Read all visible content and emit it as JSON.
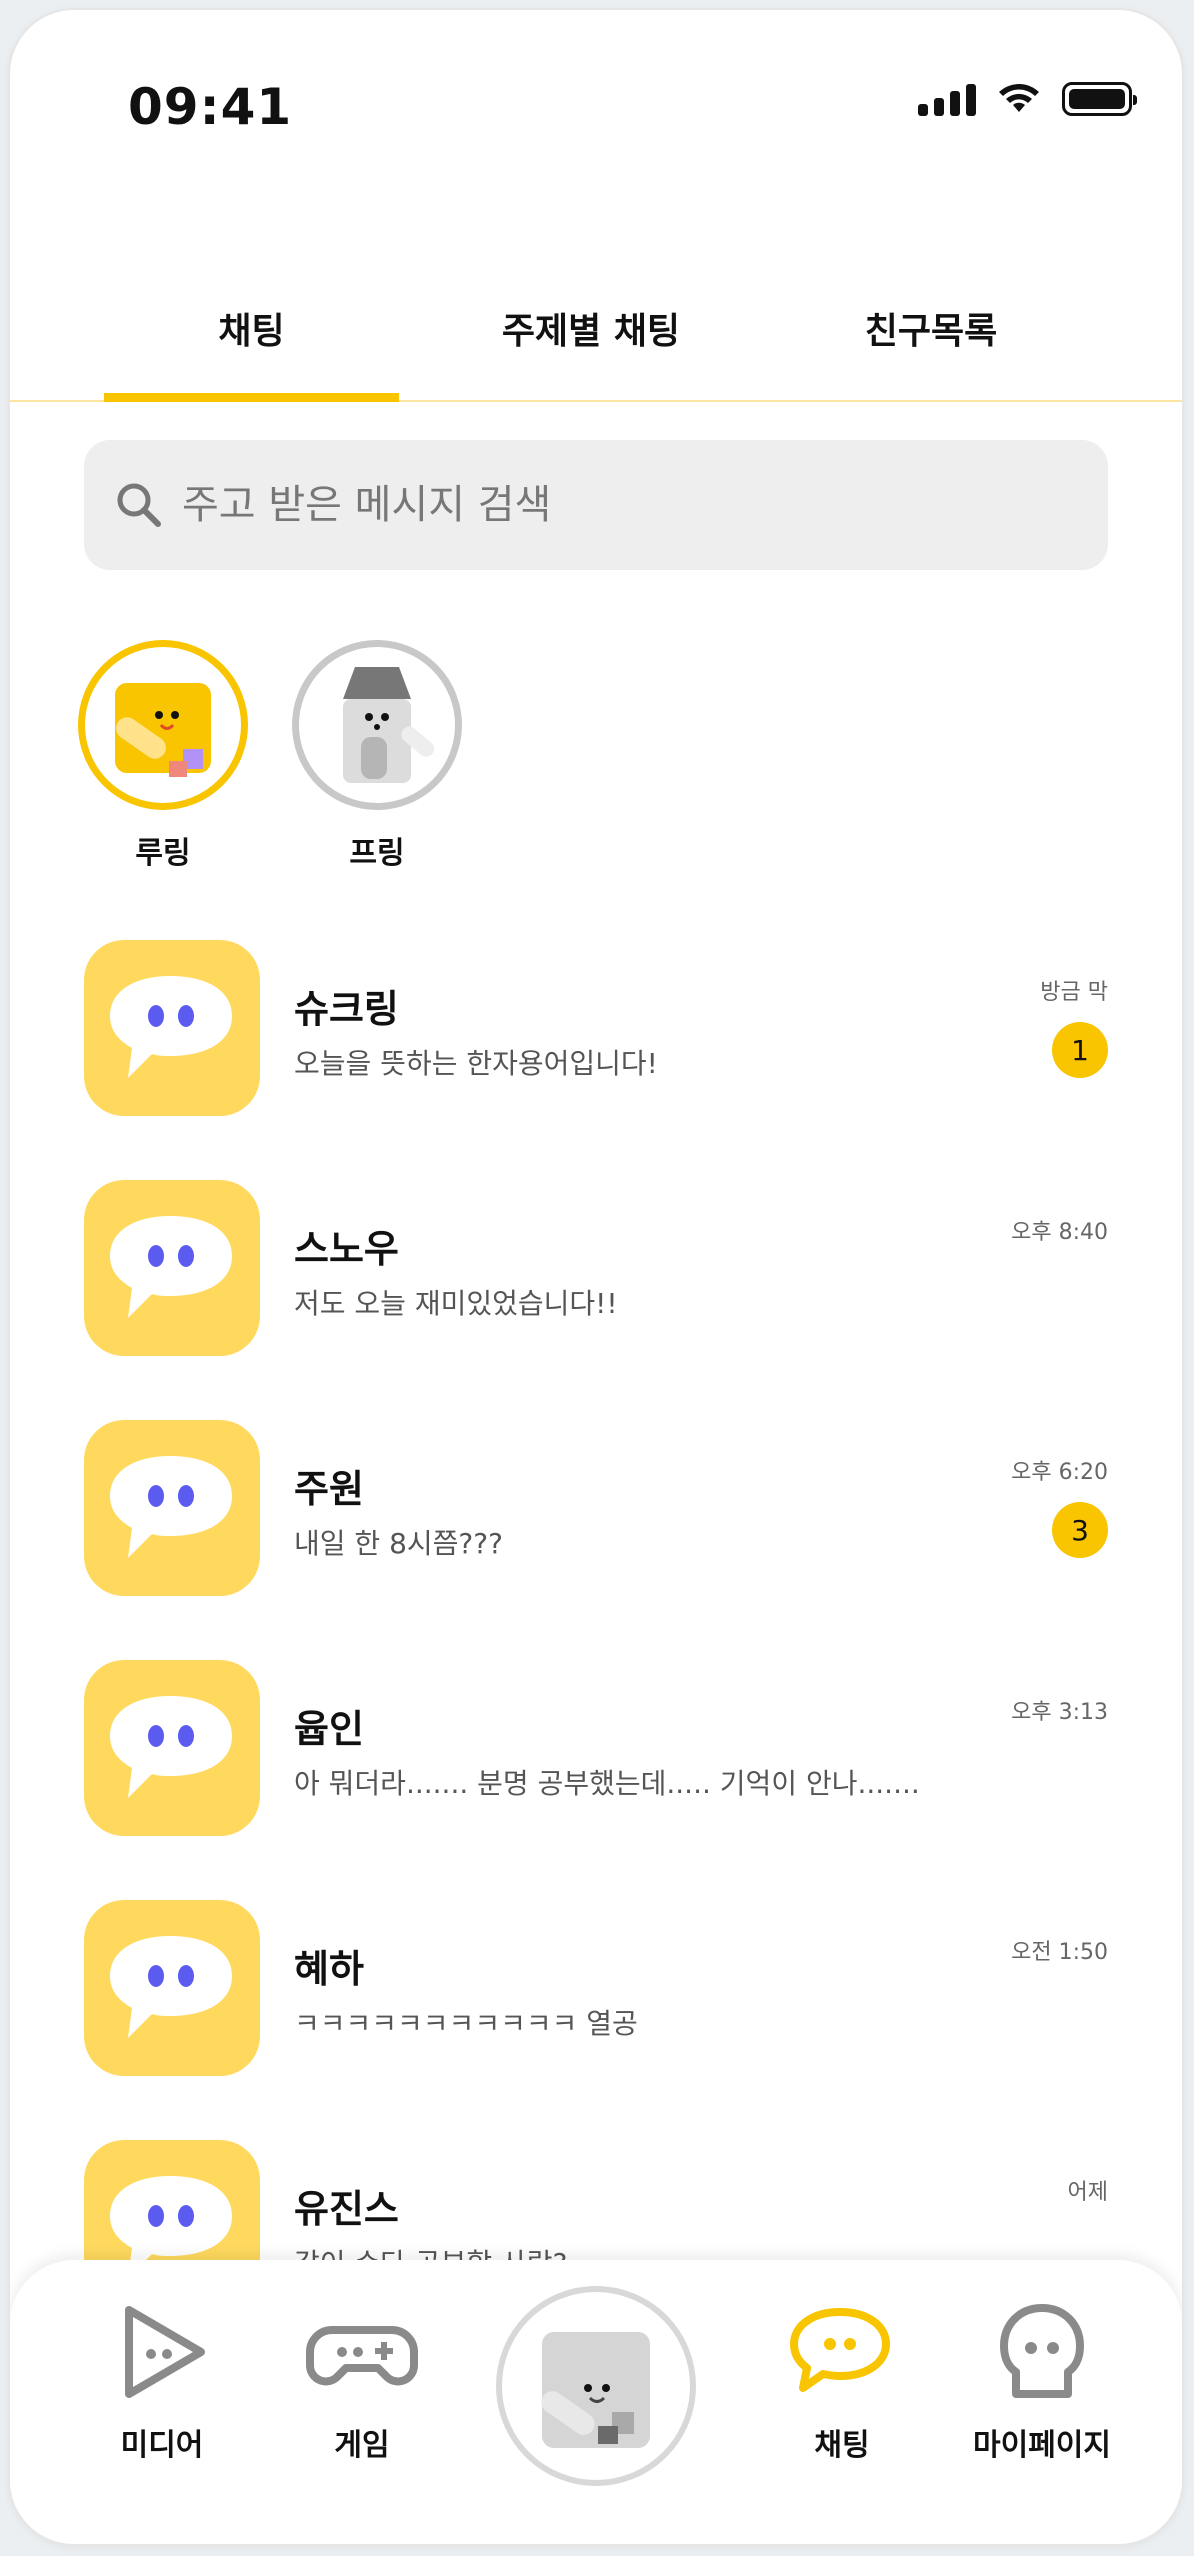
{
  "status_bar": {
    "time": "09:41"
  },
  "tabs": [
    {
      "label": "채팅",
      "active": true
    },
    {
      "label": "주제별 채팅",
      "active": false
    },
    {
      "label": "친구목록",
      "active": false
    }
  ],
  "search": {
    "placeholder": "주고 받은 메시지 검색"
  },
  "stories": [
    {
      "name": "루링"
    },
    {
      "name": "프링"
    }
  ],
  "chats": [
    {
      "name": "슈크링",
      "message": "오늘을 뜻하는 한자용어입니다!",
      "time": "방금 막",
      "unread": "1"
    },
    {
      "name": "스노우",
      "message": "저도 오늘 재미있었습니다!!",
      "time": "오후 8:40",
      "unread": ""
    },
    {
      "name": "주원",
      "message": "내일 한 8시쯤???",
      "time": "오후 6:20",
      "unread": "3"
    },
    {
      "name": "윱인",
      "message": "아 뭐더라....... 분명 공부했는데..... 기억이 안나.......",
      "time": "오후 3:13",
      "unread": ""
    },
    {
      "name": "혜하",
      "message": "ㅋㅋㅋㅋㅋㅋㅋㅋㅋㅋㅋ 열공",
      "time": "오전 1:50",
      "unread": ""
    },
    {
      "name": "유진스",
      "message": "같이 수다 공부할 사람?",
      "time": "어제",
      "unread": ""
    }
  ],
  "bottom_nav": [
    {
      "label": "미디어",
      "icon": "play-icon",
      "active": false
    },
    {
      "label": "게임",
      "icon": "gamepad-icon",
      "active": false
    },
    {
      "label": "채팅",
      "icon": "chat-bubble-icon",
      "active": true
    },
    {
      "label": "마이페이지",
      "icon": "ghost-icon",
      "active": false
    }
  ],
  "colors": {
    "accent": "#f8c500",
    "chat_icon_bg": "#ffd95e",
    "eye_color": "#5b5bf0"
  }
}
